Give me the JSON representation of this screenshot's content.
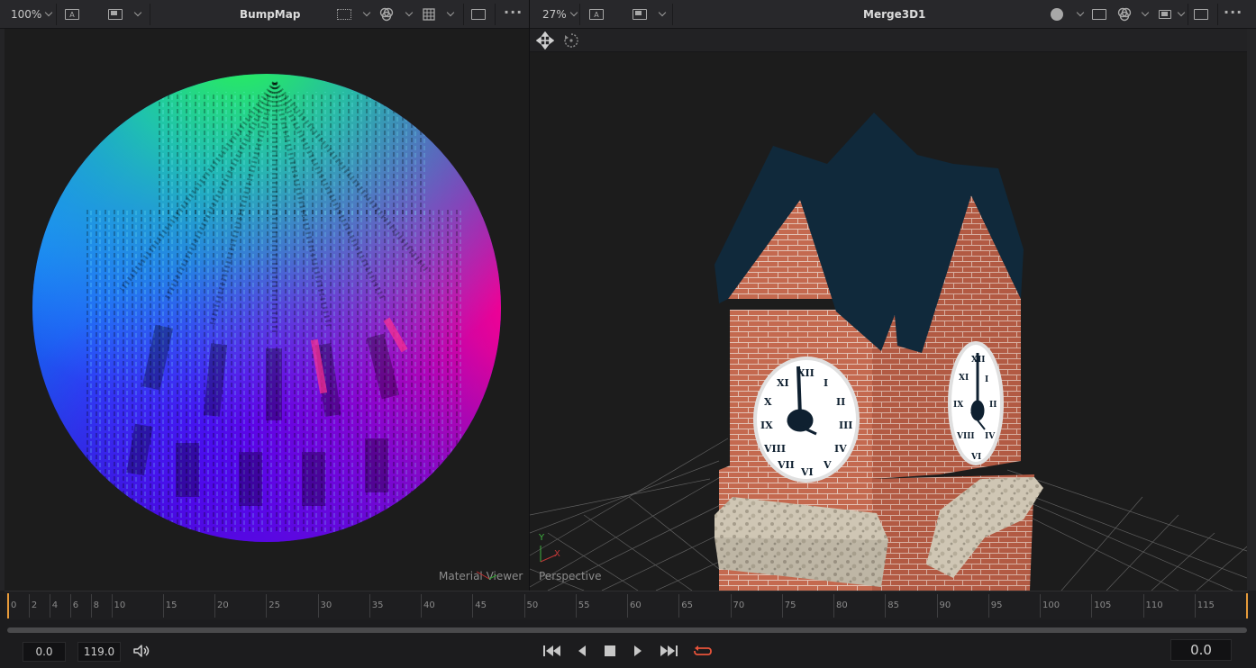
{
  "left_viewer": {
    "zoom": "100%",
    "title": "BumpMap",
    "channel_label": "A",
    "viewport_label": "Material Viewer"
  },
  "right_viewer": {
    "zoom": "27%",
    "title": "Merge3D1",
    "channel_label": "A",
    "viewport_label": "Perspective",
    "axis_y": "Y",
    "axis_x": "X"
  },
  "ruler": {
    "labels": [
      "0",
      "2",
      "4",
      "6",
      "8",
      "10",
      "15",
      "20",
      "25",
      "30",
      "35",
      "40",
      "45",
      "50",
      "55",
      "60",
      "65",
      "70",
      "75",
      "80",
      "85",
      "90",
      "95",
      "100",
      "105",
      "110",
      "115"
    ]
  },
  "transport": {
    "start_time": "0.0",
    "end_time": "119.0",
    "current_time": "0.0"
  },
  "icons": {
    "speaker": "speaker-icon",
    "first": "go-to-start-icon",
    "prev": "step-back-icon",
    "stop": "stop-icon",
    "play": "play-icon",
    "last": "go-to-end-icon",
    "loop": "loop-icon"
  },
  "colors": {
    "loop_accent": "#e8533a",
    "playhead": "#e69a3a",
    "roof": "#10293b",
    "brick": "#c1664e"
  }
}
